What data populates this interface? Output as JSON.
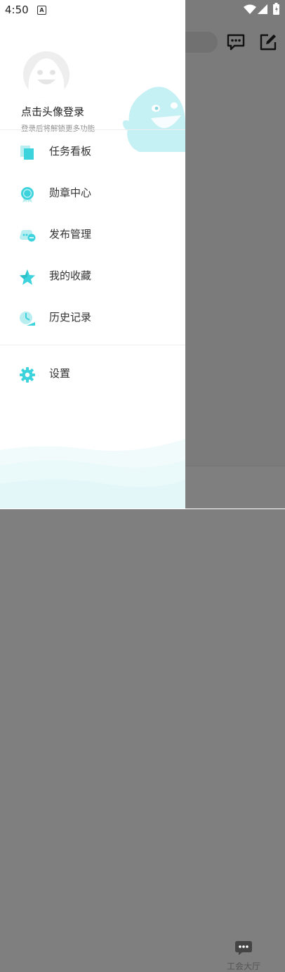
{
  "status_bar": {
    "time": "4:50",
    "notification_badge": "A"
  },
  "drawer": {
    "header": {
      "login_title": "点击头像登录",
      "login_subtitle": "登录后将解锁更多功能"
    },
    "menu_items": [
      {
        "label": "任务看板",
        "icon": "task-board-icon"
      },
      {
        "label": "勋章中心",
        "icon": "medal-icon"
      },
      {
        "label": "发布管理",
        "icon": "publish-manage-icon"
      },
      {
        "label": "我的收藏",
        "icon": "star-icon"
      },
      {
        "label": "历史记录",
        "icon": "history-icon"
      }
    ],
    "settings": {
      "label": "设置",
      "icon": "gear-icon"
    }
  },
  "background": {
    "bottom_tab": {
      "label": "工会大厅",
      "icon": "chat-bubble-icon"
    },
    "top_icons": [
      "message-icon",
      "edit-icon"
    ]
  },
  "colors": {
    "accent": "#3cd3dc",
    "accent_light": "#bff0f3"
  }
}
